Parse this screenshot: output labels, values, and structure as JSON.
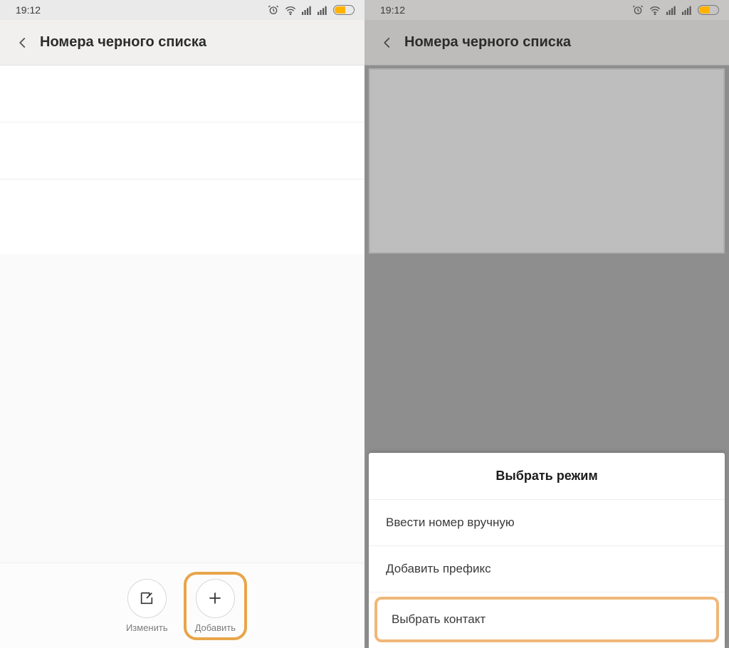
{
  "status": {
    "time": "19:12",
    "icons": [
      "alarm-icon",
      "wifi-icon",
      "signal-icon",
      "signal-icon",
      "battery-icon"
    ]
  },
  "left": {
    "title": "Номера черного списка",
    "bottom": {
      "edit_label": "Изменить",
      "add_label": "Добавить"
    }
  },
  "right": {
    "title": "Номера черного списка",
    "sheet": {
      "title": "Выбрать режим",
      "items": [
        "Ввести номер вручную",
        "Добавить префикс",
        "Выбрать контакт"
      ]
    }
  },
  "colors": {
    "accent": "#e8a54a",
    "sheet_highlight": "#f0b779",
    "battery_fill": "#ffb300"
  }
}
